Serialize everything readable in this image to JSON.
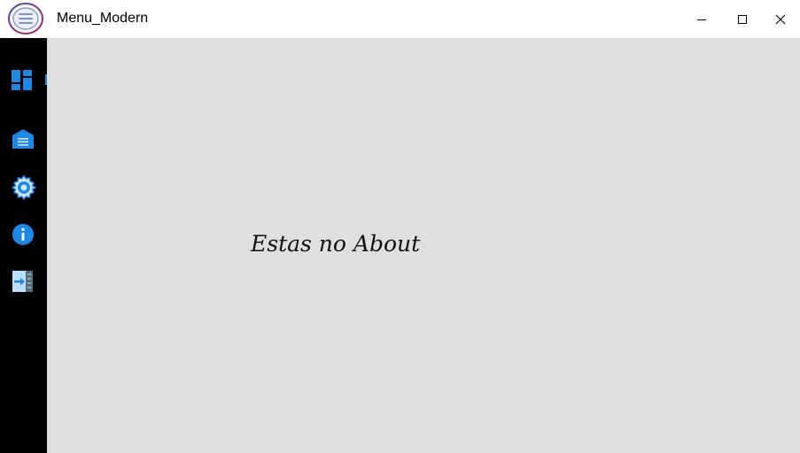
{
  "window": {
    "title": "Menu_Modern",
    "app_icon": "menu-circle-icon",
    "controls": {
      "minimize": "minimize-icon",
      "maximize": "maximize-icon",
      "close": "close-icon"
    }
  },
  "sidebar": {
    "background": "#000000",
    "accent": "#1e88e5",
    "items": [
      {
        "icon": "dashboard-icon"
      },
      {
        "icon": "home-icon"
      },
      {
        "icon": "settings-gear-icon"
      },
      {
        "icon": "info-icon"
      },
      {
        "icon": "exit-icon"
      }
    ]
  },
  "main": {
    "background": "#dfdfdf",
    "message": "Estas no About"
  }
}
